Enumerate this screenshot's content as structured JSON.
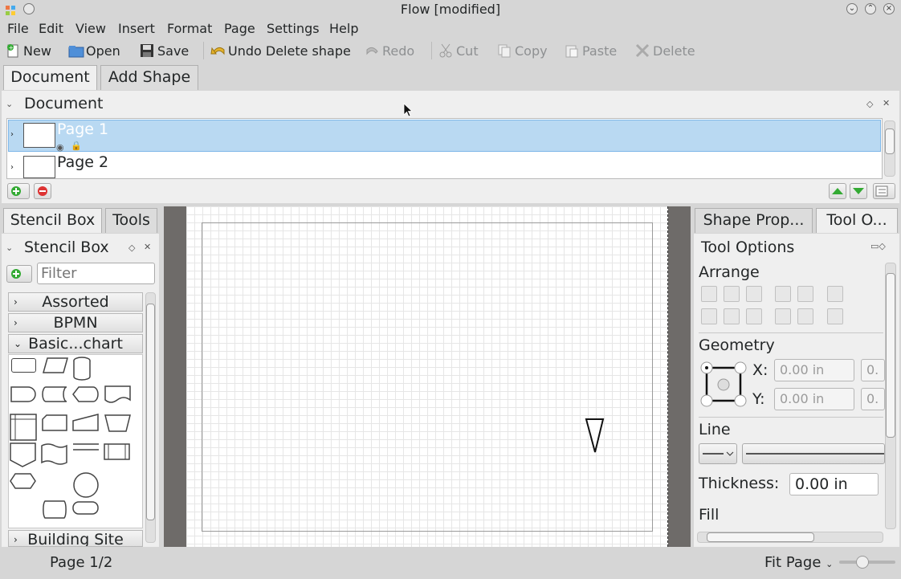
{
  "window": {
    "title": "Flow [modified]"
  },
  "menu": [
    "File",
    "Edit",
    "View",
    "Insert",
    "Format",
    "Page",
    "Settings",
    "Help"
  ],
  "toolbar": {
    "new": "New",
    "open": "Open",
    "save": "Save",
    "undo": "Undo Delete shape",
    "redo": "Redo",
    "cut": "Cut",
    "copy": "Copy",
    "paste": "Paste",
    "delete": "Delete"
  },
  "top_tabs": [
    "Document",
    "Add Shape"
  ],
  "document_panel": {
    "title": "Document",
    "pages": [
      "Page 1",
      "Page 2"
    ]
  },
  "left_tabs": [
    "Stencil Box",
    "Tools"
  ],
  "stencil": {
    "title": "Stencil Box",
    "filter_placeholder": "Filter",
    "categories": [
      "Assorted",
      "BPMN",
      "Basic...chart",
      "Building Site"
    ]
  },
  "right_tabs": [
    "Shape Prop...",
    "Tool O..."
  ],
  "tool_options": {
    "title": "Tool Options",
    "arrange": "Arrange",
    "geometry": "Geometry",
    "x_label": "X:",
    "x_value": "0.00 in",
    "y_label": "Y:",
    "y_value": "0.00 in",
    "w_value": "0.",
    "h_value": "0.",
    "line": "Line",
    "thickness_label": "Thickness:",
    "thickness_value": "0.00 in",
    "fill": "Fill"
  },
  "statusbar": {
    "page": "Page 1/2",
    "zoom": "Fit Page"
  }
}
